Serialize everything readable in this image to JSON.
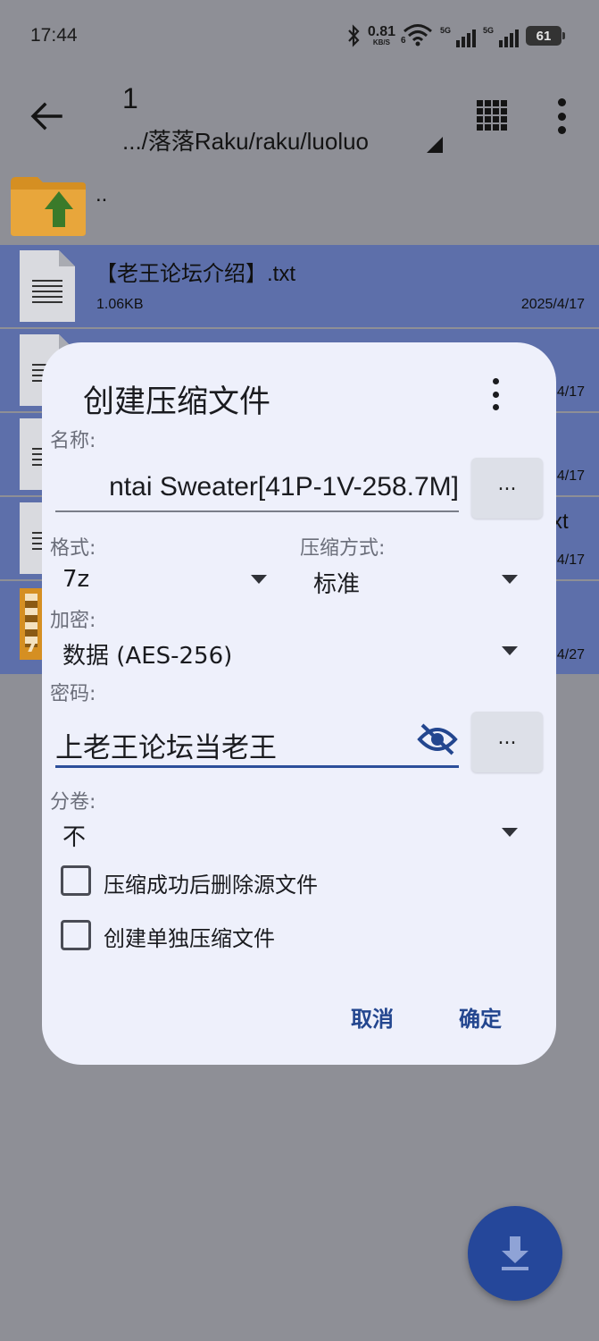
{
  "status_bar": {
    "time": "17:44",
    "net_speed_value": "0.81",
    "net_speed_unit": "KB/S",
    "wifi_badge": "6",
    "sim1_tag": "5G",
    "sim2_tag": "5G",
    "battery_level": "61"
  },
  "toolbar": {
    "title": "1",
    "path": ".../落落Raku/raku/luoluo"
  },
  "file_list": {
    "parent_label": "..",
    "items": [
      {
        "name": "【老王论坛介绍】.txt",
        "size": "1.06KB",
        "date": "2025/4/17"
      },
      {
        "date_fragment": "4/17"
      },
      {
        "date_fragment": "4/17"
      },
      {
        "name_fragment": "xt",
        "date_fragment": "4/17"
      },
      {
        "badge": "7",
        "date_fragment": "4/27"
      }
    ]
  },
  "dialog": {
    "title": "创建压缩文件",
    "name_label": "名称:",
    "name_value": "ntai Sweater[41P-1V-258.7M]",
    "name_more_label": "...",
    "format_label": "格式:",
    "format_value": "7z",
    "method_label": "压缩方式:",
    "method_value": "标准",
    "encrypt_label": "加密:",
    "encrypt_value": "数据 (AES-256)",
    "password_label": "密码:",
    "password_value": "上老王论坛当老王",
    "password_more_label": "...",
    "split_label": "分卷:",
    "split_value": "不",
    "checkbox_delete_label": "压缩成功后删除源文件",
    "checkbox_delete_checked": false,
    "checkbox_separate_label": "创建单独压缩文件",
    "checkbox_separate_checked": false,
    "cancel_label": "取消",
    "ok_label": "确定"
  },
  "colors": {
    "dim_background": "#8e8f96",
    "selected_row": "#5d6faa",
    "dialog_bg": "#eef0fb",
    "accent": "#23468f",
    "fab": "#25479a"
  },
  "icons": {
    "back": "arrow-left-icon",
    "grid": "grid-view-icon",
    "overflow": "more-vertical-icon",
    "parent_folder": "folder-up-icon",
    "text_file": "text-file-icon",
    "password_visibility": "eye-off-icon",
    "fab": "download-icon"
  }
}
